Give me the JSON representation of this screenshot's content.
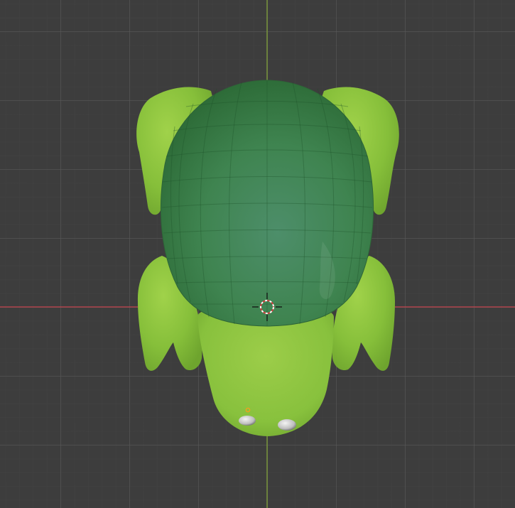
{
  "viewport": {
    "background": "#3d3d3d",
    "x_axis_color": "#c4434e",
    "y_axis_color": "#7fa03a"
  },
  "model": {
    "name": "turtle",
    "shell_color": "#3d8a4e",
    "body_color": "#8cc63f"
  },
  "cursor": {
    "icon": "3d-cursor-icon"
  }
}
